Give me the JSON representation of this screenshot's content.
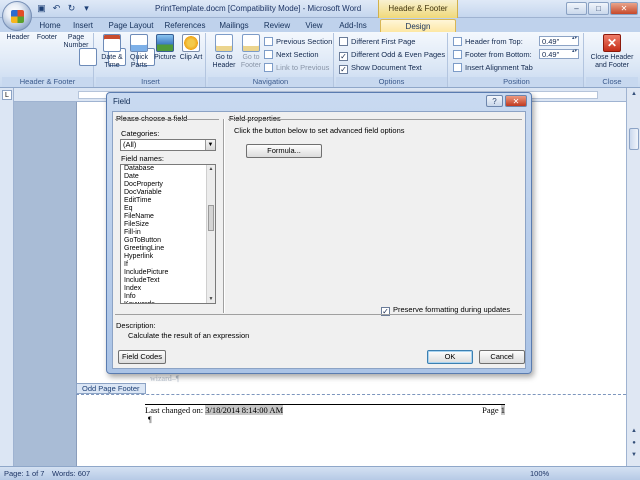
{
  "window": {
    "title": "PrintTemplate.docm [Compatibility Mode] - Microsoft Word",
    "context_tab": "Header & Footer Tools",
    "controls": [
      "–",
      "□",
      "✕"
    ]
  },
  "ribbon_tabs": [
    "Home",
    "Insert",
    "Page Layout",
    "References",
    "Mailings",
    "Review",
    "View",
    "Add-Ins",
    "Design"
  ],
  "ribbon": {
    "header_footer_group": {
      "label": "Header & Footer",
      "header": "Header",
      "footer": "Footer",
      "page_number": "Page Number"
    },
    "insert_group": {
      "label": "Insert",
      "date_time": "Date & Time",
      "quick_parts": "Quick Parts",
      "picture": "Picture",
      "clip_art": "Clip Art"
    },
    "navigation_group": {
      "label": "Navigation",
      "goto_header": "Go to Header",
      "goto_footer": "Go to Footer",
      "previous_section": "Previous Section",
      "next_section": "Next Section",
      "link_to_previous": "Link to Previous"
    },
    "options_group": {
      "label": "Options",
      "different_first_page": "Different First Page",
      "different_odd_even": "Different Odd & Even Pages",
      "show_document_text": "Show Document Text",
      "different_first_page_checked": false,
      "different_odd_even_checked": true,
      "show_document_text_checked": true
    },
    "position_group": {
      "label": "Position",
      "header_from_top": "Header from Top:",
      "header_from_top_value": "0.49\"",
      "footer_from_bottom": "Footer from Bottom:",
      "footer_from_bottom_value": "0.49\"",
      "insert_alignment_tab": "Insert Alignment Tab"
    },
    "close_group": {
      "label": "Close",
      "close_header_footer": "Close Header and Footer"
    }
  },
  "document": {
    "footer_tag": "Odd Page Footer",
    "wizard_text": "wizard–¶",
    "footer_prefix": "Last changed on: ",
    "footer_date_field": "3/18/2014  8:14:00 AM",
    "footer_page_label": "Page ",
    "footer_page_num": "1",
    "pilcrow": "¶"
  },
  "status": {
    "page": "Page: 1 of 7",
    "words": "Words: 607",
    "zoom": "100%"
  },
  "dialog": {
    "title": "Field",
    "choose_label": "Please choose a field",
    "categories_label": "Categories:",
    "categories_value": "(All)",
    "field_names_label": "Field names:",
    "field_names": [
      "Database",
      "Date",
      "DocProperty",
      "DocVariable",
      "EditTime",
      "Eq",
      "FileName",
      "FileSize",
      "Fill-in",
      "GoToButton",
      "GreetingLine",
      "Hyperlink",
      "If",
      "IncludePicture",
      "IncludeText",
      "Index",
      "Info",
      "Keywords"
    ],
    "field_properties_label": "Field properties",
    "advanced_hint": "Click the button below to set advanced field options",
    "formula_button": "Formula...",
    "preserve_label": "Preserve formatting during updates",
    "preserve_checked": true,
    "description_label": "Description:",
    "description_text": "Calculate the result of an expression",
    "field_codes_button": "Field Codes",
    "ok_button": "OK",
    "cancel_button": "Cancel",
    "help": "?",
    "close": "✕"
  }
}
